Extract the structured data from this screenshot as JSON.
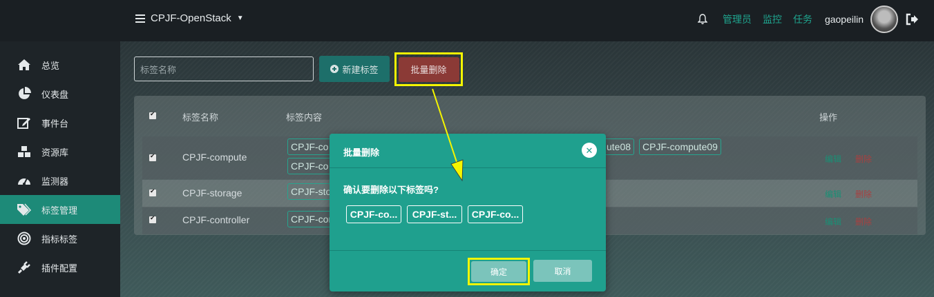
{
  "topbar": {
    "project": "CPJF-OpenStack",
    "links": [
      "管理员",
      "监控",
      "任务"
    ],
    "username": "gaopeilin"
  },
  "sidebar": {
    "items": [
      {
        "label": "总览",
        "icon": "home-icon"
      },
      {
        "label": "仪表盘",
        "icon": "pie-chart-icon"
      },
      {
        "label": "事件台",
        "icon": "edit-icon"
      },
      {
        "label": "资源库",
        "icon": "cubes-icon"
      },
      {
        "label": "监测器",
        "icon": "dashboard-icon"
      },
      {
        "label": "标签管理",
        "icon": "tags-icon",
        "active": true
      },
      {
        "label": "指标标签",
        "icon": "bullseye-icon"
      },
      {
        "label": "插件配置",
        "icon": "plug-icon"
      }
    ]
  },
  "toolbar": {
    "search_placeholder": "标签名称",
    "new_label": "新建标签",
    "bulk_delete_label": "批量删除"
  },
  "table": {
    "headers": [
      "标签名称",
      "标签内容",
      "操作"
    ],
    "rows": [
      {
        "name": "CPJF-compute",
        "chips_line1": [
          "CPJF-co",
          "ute08",
          "CPJF-compute09"
        ],
        "chips_line2": [
          "CPJF-co"
        ]
      },
      {
        "name": "CPJF-storage",
        "chips_line1": [
          "CPJF-sto"
        ]
      },
      {
        "name": "CPJF-controller",
        "chips_line1": [
          "CPJF-cor"
        ]
      }
    ],
    "action_edit": "编辑",
    "action_delete": "删除"
  },
  "modal": {
    "title": "批量删除",
    "question": "确认要删除以下标签吗?",
    "chips": [
      "CPJF-co...",
      "CPJF-st...",
      "CPJF-co..."
    ],
    "ok_label": "确定",
    "cancel_label": "取消"
  },
  "colors": {
    "accent": "#1fa08e",
    "danger": "#8b3a36",
    "highlight": "#f5f500"
  }
}
